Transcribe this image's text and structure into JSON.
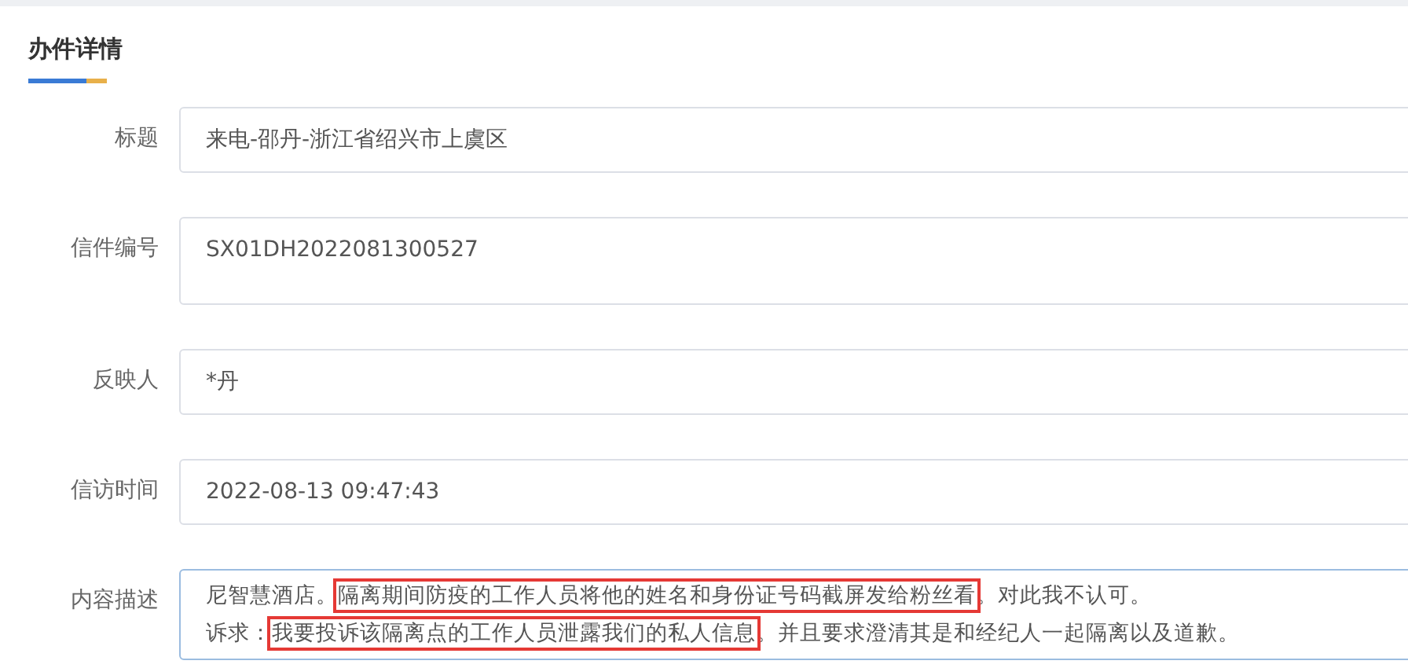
{
  "section": {
    "title": "办件详情"
  },
  "fields": [
    {
      "label": "标题",
      "value": "来电-邵丹-浙江省绍兴市上虞区",
      "kind": "single"
    },
    {
      "label": "信件编号",
      "value": "SX01DH2022081300527",
      "kind": "tall"
    },
    {
      "label": "反映人",
      "value": "*丹",
      "kind": "single"
    },
    {
      "label": "信访时间",
      "value": "2022-08-13 09:47:43",
      "kind": "single"
    }
  ],
  "content": {
    "label": "内容描述",
    "lines": [
      [
        {
          "text": "尼智慧酒店。",
          "highlighted": false
        },
        {
          "text": "隔离期间防疫的工作人员将他的姓名和身份证号码截屏发给粉丝看",
          "highlighted": true
        },
        {
          "text": "。对此我不认可。",
          "highlighted": false
        }
      ],
      [
        {
          "text": "诉求：",
          "highlighted": false
        },
        {
          "text": "我要投诉该隔离点的工作人员泄露我们的私人信息",
          "highlighted": true
        },
        {
          "text": "。并且要求澄清其是和经纪人一起隔离以及道歉。",
          "highlighted": false
        }
      ]
    ]
  }
}
